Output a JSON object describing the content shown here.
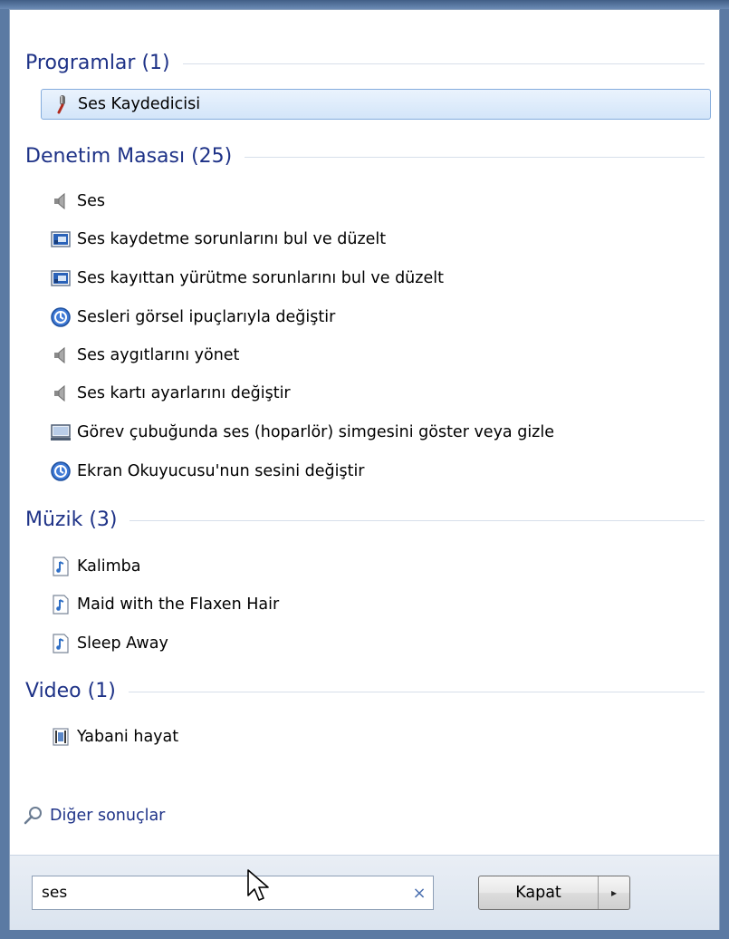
{
  "groups": {
    "programs": {
      "title": "Programlar (1)"
    },
    "control_panel": {
      "title": "Denetim Masası (25)"
    },
    "music": {
      "title": "Müzik (3)"
    },
    "video": {
      "title": "Video (1)"
    }
  },
  "items": {
    "programs": [
      {
        "label": "Ses Kaydedicisi",
        "icon": "microphone-icon"
      }
    ],
    "control_panel": [
      {
        "label": "Ses",
        "icon": "speaker-icon"
      },
      {
        "label": "Ses kaydetme sorunlarını bul ve düzelt",
        "icon": "troubleshoot-icon"
      },
      {
        "label": "Ses kayıttan yürütme sorunlarını bul ve düzelt",
        "icon": "troubleshoot-icon"
      },
      {
        "label": "Sesleri görsel ipuçlarıyla değiştir",
        "icon": "ease-of-access-icon"
      },
      {
        "label": "Ses aygıtlarını yönet",
        "icon": "speaker-icon"
      },
      {
        "label": "Ses kartı ayarlarını değiştir",
        "icon": "speaker-icon"
      },
      {
        "label": "Görev çubuğunda ses (hoparlör) simgesini göster veya gizle",
        "icon": "taskbar-icon"
      },
      {
        "label": "Ekran Okuyucusu'nun sesini değiştir",
        "icon": "ease-of-access-icon"
      }
    ],
    "music": [
      {
        "label": "Kalimba",
        "icon": "music-file-icon"
      },
      {
        "label": "Maid with the Flaxen Hair",
        "icon": "music-file-icon"
      },
      {
        "label": "Sleep Away",
        "icon": "music-file-icon"
      }
    ],
    "video": [
      {
        "label": "Yabani hayat",
        "icon": "video-file-icon"
      }
    ]
  },
  "more_results": {
    "label": "Diğer sonuçlar",
    "icon": "search-icon"
  },
  "search": {
    "value": "ses",
    "clear_symbol": "×"
  },
  "shutdown": {
    "label": "Kapat",
    "arrow": "▸"
  },
  "colors": {
    "group_title": "#1e3287",
    "selection_border": "#84acdd",
    "panel_background": "#ffffff"
  }
}
